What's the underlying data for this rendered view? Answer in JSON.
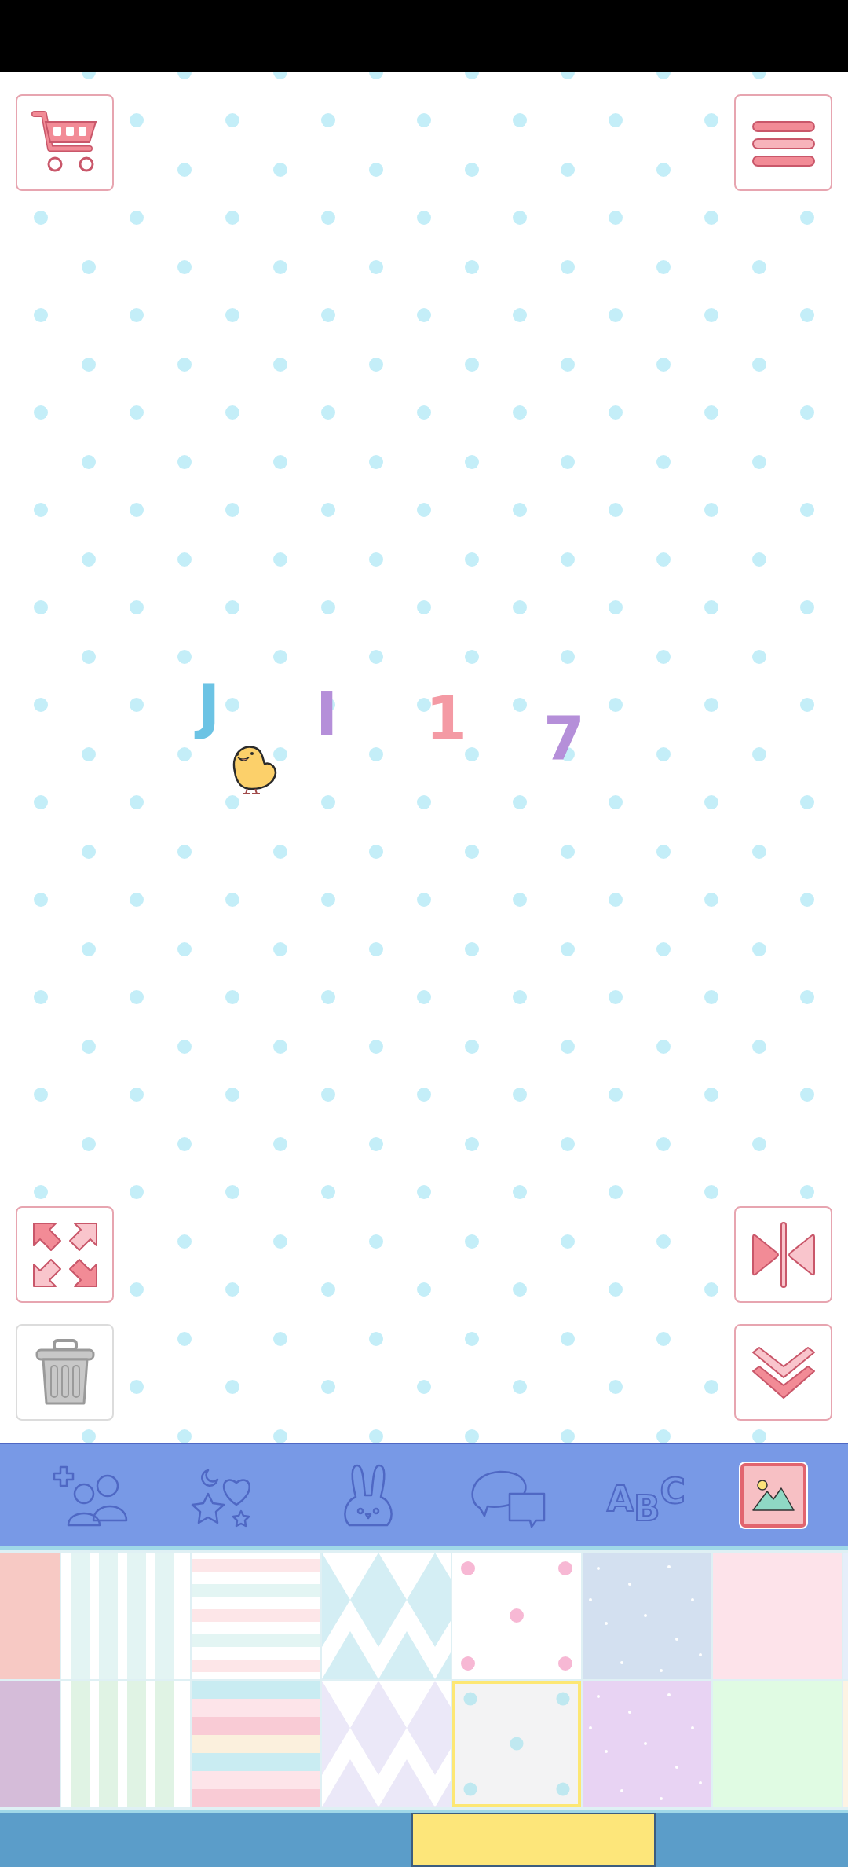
{
  "stickers": [
    {
      "kind": "letter",
      "text": "J",
      "color": "#6cc3e4"
    },
    {
      "kind": "letter",
      "text": "I",
      "color": "#b58fd9"
    },
    {
      "kind": "letter",
      "text": "1",
      "color": "#f49aa4"
    },
    {
      "kind": "letter",
      "text": "7",
      "color": "#b58fd9"
    },
    {
      "kind": "chick"
    }
  ],
  "tabs": [
    {
      "kind": "people",
      "selected": false
    },
    {
      "kind": "shapes",
      "selected": false
    },
    {
      "kind": "bunny",
      "selected": false
    },
    {
      "kind": "speech",
      "selected": false
    },
    {
      "kind": "letters",
      "label": "ABC",
      "selected": false
    },
    {
      "kind": "image",
      "selected": true
    }
  ],
  "pattern_rows": [
    [
      {
        "kind": "solid",
        "color": "#f7c9c4",
        "selected": false
      },
      {
        "kind": "vstripes",
        "color": "#e3f4f3",
        "selected": false
      },
      {
        "kind": "hstripes",
        "color": "#fde6e8",
        "selected": false
      },
      {
        "kind": "diamonds",
        "color": "#d4eef4",
        "selected": false
      },
      {
        "kind": "dots",
        "color": "#f7b8d4",
        "selected": false
      },
      {
        "kind": "stars",
        "color": "#d3e0f0",
        "selected": false
      },
      {
        "kind": "solid",
        "color": "#fde3ea",
        "selected": false
      },
      {
        "kind": "solid",
        "color": "#e6eefa",
        "selected": false
      }
    ],
    [
      {
        "kind": "solid",
        "color": "#d5bcd9",
        "selected": false
      },
      {
        "kind": "vstripes",
        "color": "#e0f3e4",
        "selected": false
      },
      {
        "kind": "bands",
        "color": "#f9cbd5",
        "selected": false
      },
      {
        "kind": "diamonds",
        "color": "#ebe8f8",
        "selected": false
      },
      {
        "kind": "dots",
        "color": "#bfe8f0",
        "selected": true
      },
      {
        "kind": "stars",
        "color": "#e8d3f3",
        "selected": false
      },
      {
        "kind": "solid",
        "color": "#e0fbe3",
        "selected": false
      },
      {
        "kind": "solid",
        "color": "#fdf3e3",
        "selected": false
      }
    ]
  ]
}
